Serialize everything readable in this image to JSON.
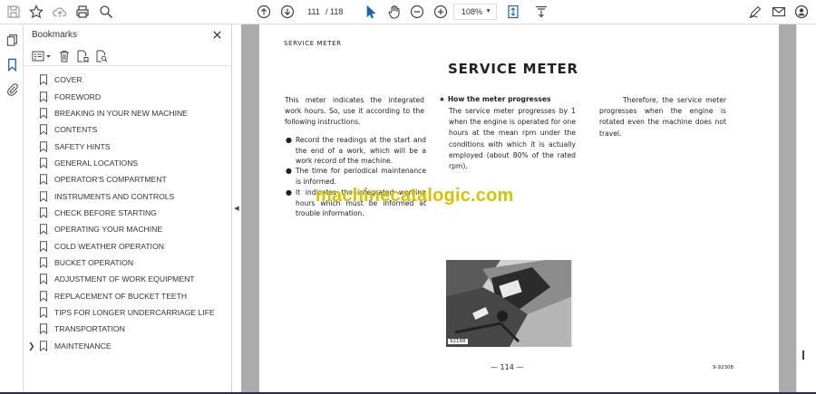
{
  "toolbar": {
    "page_current": "111",
    "page_total": "/  118",
    "zoom": "108%"
  },
  "bookmarks": {
    "title": "Bookmarks",
    "items": [
      {
        "label": "COVER",
        "expandable": false
      },
      {
        "label": "FOREWORD",
        "expandable": false
      },
      {
        "label": "BREAKING IN YOUR NEW MACHINE",
        "expandable": false
      },
      {
        "label": "CONTENTS",
        "expandable": false
      },
      {
        "label": "SAFETY HINTS",
        "expandable": false
      },
      {
        "label": "GENERAL LOCATIONS",
        "expandable": false
      },
      {
        "label": "OPERATOR'S COMPARTMENT",
        "expandable": false
      },
      {
        "label": "INSTRUMENTS AND CONTROLS",
        "expandable": false
      },
      {
        "label": "CHECK BEFORE STARTING",
        "expandable": false
      },
      {
        "label": "OPERATING YOUR MACHINE",
        "expandable": false
      },
      {
        "label": "COLD WEATHER OPERATION",
        "expandable": false
      },
      {
        "label": "BUCKET OPERATION",
        "expandable": false
      },
      {
        "label": "ADJUSTMENT OF WORK EQUIPMENT",
        "expandable": false
      },
      {
        "label": "REPLACEMENT OF BUCKET TEETH",
        "expandable": false
      },
      {
        "label": "TIPS FOR LONGER UNDERCARRIAGE LIFE",
        "expandable": false
      },
      {
        "label": "TRANSPORTATION",
        "expandable": false
      },
      {
        "label": "MAINTENANCE",
        "expandable": true
      }
    ]
  },
  "document": {
    "header": "SERVICE METER",
    "title": "SERVICE METER",
    "intro": "This meter indicates the integrated work hours. So, use it according to the following instructions.",
    "bullets": [
      "Record the readings at the start and the end of a work, which will be a work record of the machine.",
      "The time for periodical maintenance is informed.",
      "It indicates the integrated working hours which must be informed at trouble information."
    ],
    "how_heading_star": "★",
    "how_heading": "How the meter progresses",
    "how_text": "The service meter progresses by 1 when the engine is operated for one hours at the mean rpm under the conditions with which it is actually employed (about 80% of the rated rpm).",
    "therefore_text": "Therefore, the service meter progresses when the engine is rotated even the machine does not travel.",
    "photo_code": "92188",
    "page_number": "— 114 —",
    "doc_code": "9-92308",
    "watermark": "machinecatalogic.com"
  }
}
